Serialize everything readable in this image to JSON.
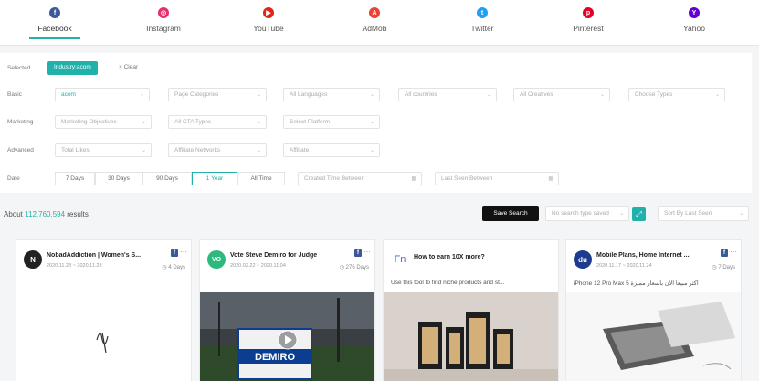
{
  "platforms": [
    {
      "label": "Facebook",
      "color": "#3b5998",
      "glyph": "f",
      "icon": "facebook-icon",
      "active": true
    },
    {
      "label": "Instagram",
      "color": "#e1306c",
      "glyph": "◎",
      "icon": "instagram-icon",
      "active": false
    },
    {
      "label": "YouTube",
      "color": "#e62117",
      "glyph": "▶",
      "icon": "youtube-icon",
      "active": false
    },
    {
      "label": "AdMob",
      "color": "#ea4335",
      "glyph": "A",
      "icon": "admob-icon",
      "active": false
    },
    {
      "label": "Twitter",
      "color": "#1da1f2",
      "glyph": "t",
      "icon": "twitter-icon",
      "active": false
    },
    {
      "label": "Pinterest",
      "color": "#e60023",
      "glyph": "p",
      "icon": "pinterest-icon",
      "active": false
    },
    {
      "label": "Yahoo",
      "color": "#6001d2",
      "glyph": "Y",
      "icon": "yahoo-icon",
      "active": false
    }
  ],
  "filters": {
    "selected_label": "Selected",
    "selected_chip": "Industry:acom",
    "clear_label": "× Clear",
    "basic_label": "Basic",
    "basic": [
      "acom",
      "Page Categories",
      "All Languages",
      "All countries",
      "All Creatives",
      "Choose Types"
    ],
    "marketing_label": "Marketing",
    "marketing": [
      "Marketing Objectives",
      "All CTA Types",
      "Select Platform"
    ],
    "advanced_label": "Advanced",
    "advanced": [
      "Total Likes",
      "Affiliate Networks",
      "Affiliate"
    ],
    "date_label": "Date",
    "date_ranges": [
      "7 Days",
      "30 Days",
      "90 Days",
      "1 Year",
      "All Time"
    ],
    "date_active": "1 Year",
    "first_seen_placeholder": "Created Time Between",
    "last_seen_placeholder": "Last Seen Between"
  },
  "results": {
    "prefix": "About ",
    "count": "112,760,594",
    "suffix": " results",
    "save_search": "Save Search",
    "saved_search_placeholder": "No search type saved",
    "sort_placeholder": "Sort By Last Seen"
  },
  "cards": [
    {
      "title": "NobadAddiction | Women's S...",
      "date": "2020.11.28 ~ 2020.11.28",
      "days": "4 Days",
      "desc": "",
      "avatar_color": "#222222",
      "avatar_glyph": "N"
    },
    {
      "title": "Vote Steve Demiro for Judge",
      "date": "2020.02.22 ~ 2020.11.04",
      "days": "276 Days",
      "desc": "",
      "avatar_color": "#2db87d",
      "avatar_glyph": "VO"
    },
    {
      "title": "How to earn 10X more?",
      "date": "",
      "days": "",
      "desc": "Use this tool to find niche products and st...",
      "avatar_color": "#ffffff",
      "avatar_glyph": "Fn"
    },
    {
      "title": "Mobile Plans, Home Internet ...",
      "date": "2020.11.17 ~ 2020.11.24",
      "days": "7 Days",
      "desc": "iPhone 12 Pro Max 5 أكثر مبيعاً الآن بأسعار مميزة",
      "avatar_color": "#1f3b8f",
      "avatar_glyph": "du"
    }
  ],
  "sign_text": "DEMIRO"
}
